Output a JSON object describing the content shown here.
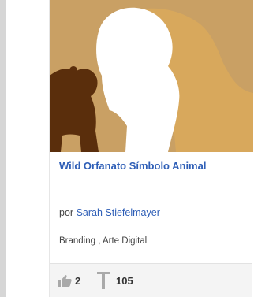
{
  "project": {
    "title": "Wild Orfanato Símbolo Animal",
    "by_label": "por",
    "author": "Sarah Stiefelmayer",
    "fields": "Branding , Arte Digital"
  },
  "stats": {
    "likes": "2",
    "views": "105"
  },
  "icons": {
    "likes": "thumbs-up-icon",
    "views": "views-icon"
  },
  "colors": {
    "link": "#2f5fb7",
    "thumb_background": "#c9a064",
    "lion": "#ffffff",
    "bear": "#d7a85c",
    "small_animal": "#5a2e0c"
  }
}
